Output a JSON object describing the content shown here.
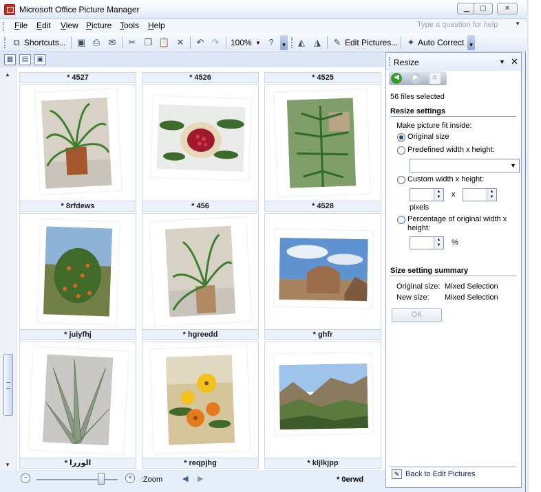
{
  "window": {
    "title": "Microsoft Office Picture Manager"
  },
  "menu": {
    "items": [
      {
        "key": "F",
        "rest": "ile"
      },
      {
        "key": "E",
        "rest": "dit"
      },
      {
        "key": "V",
        "rest": "iew"
      },
      {
        "key": "P",
        "rest": "icture"
      },
      {
        "key": "T",
        "rest": "ools"
      },
      {
        "key": "H",
        "rest": "elp"
      }
    ],
    "help_placeholder": "Type a question for help"
  },
  "toolbar": {
    "shortcuts_label": "Shortcuts...",
    "zoom_value": "100%",
    "edit_pictures_label": "Edit Pictures...",
    "auto_correct_label": "Auto Correct"
  },
  "gallery": {
    "top_captions": [
      "* 4527",
      "* 4526",
      "* 4525"
    ],
    "rows": [
      [
        {
          "caption": "* 8rfdews",
          "icon": "fern-photo"
        },
        {
          "caption": "* 456",
          "icon": "pomegranate-photo"
        },
        {
          "caption": "* 4528",
          "icon": "pine-photo"
        }
      ],
      [
        {
          "caption": "* juiyfhj",
          "icon": "orange-tree-photo"
        },
        {
          "caption": "* hgreedd",
          "icon": "fern-photo"
        },
        {
          "caption": "* ghfr",
          "icon": "ruins-photo"
        }
      ],
      [
        {
          "caption": "* الوررا",
          "icon": "aloe-photo"
        },
        {
          "caption": "* reqpjhg",
          "icon": "flowers-photo"
        },
        {
          "caption": "* kljlkjpp",
          "icon": "valley-photo"
        }
      ]
    ]
  },
  "statusbar": {
    "zoom_label": ":Zoom",
    "zoom_fraction": 0.8,
    "selection_name": "* 0erwd"
  },
  "taskpane": {
    "title": "Resize",
    "files_selected": "56 files selected",
    "resize_settings_heading": "Resize settings",
    "fit_inside_label": "Make picture fit inside:",
    "option_original": "Original size",
    "option_predefined": "Predefined width x height:",
    "option_custom": "Custom width x height:",
    "x_label": "x",
    "pixels_label": "pixels",
    "option_percentage_line1": "Percentage of original width x",
    "option_percentage_line2": "height:",
    "percent_label": "%",
    "summary_heading": "Size setting summary",
    "original_size_label": "Original size:",
    "original_size_value": "Mixed Selection",
    "new_size_label": "New size:",
    "new_size_value": "Mixed Selection",
    "ok_label": "OK",
    "back_link": "Back to Edit Pictures"
  },
  "colors": {
    "chrome_blue": "#e6eef9",
    "caption_bg": "#ebf2fb",
    "link_blue": "#0a2a73"
  }
}
